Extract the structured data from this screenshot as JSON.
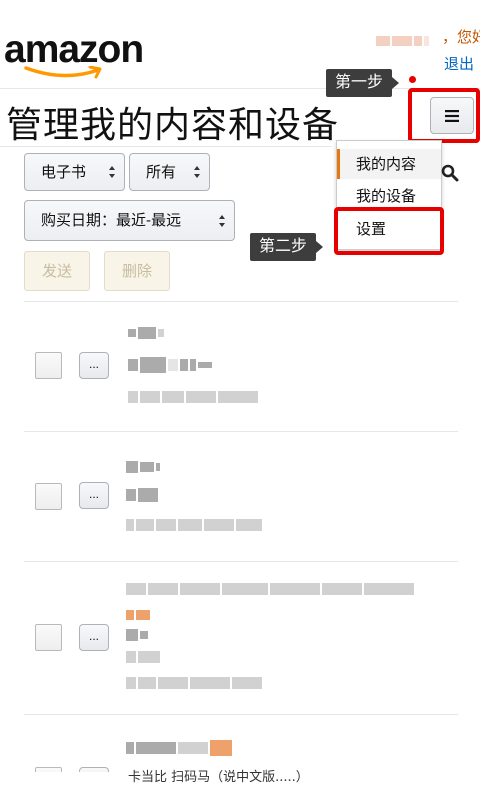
{
  "header": {
    "logo_text": "amazon",
    "greeting": "，您好",
    "logout": "退出",
    "page_title": "管理我的内容和设备",
    "accent_color": "#e47911",
    "link_color": "#0066c0",
    "highlight_color": "#e60000"
  },
  "annotations": {
    "step1": "第一步",
    "step2": "第二步"
  },
  "menu": {
    "icon": "hamburger-menu-icon",
    "items": [
      {
        "label": "我的内容",
        "active": true
      },
      {
        "label": "我的设备",
        "active": false
      },
      {
        "label": "设置",
        "active": false
      }
    ]
  },
  "filters": {
    "content_type": "电子书",
    "ownership": "所有",
    "sort": "购买日期：最近-最远"
  },
  "actions": {
    "send": "发送",
    "delete": "删除"
  },
  "list": {
    "more_button": "...",
    "partial_text": "卡当比 扫码马（说中文版.....）"
  }
}
